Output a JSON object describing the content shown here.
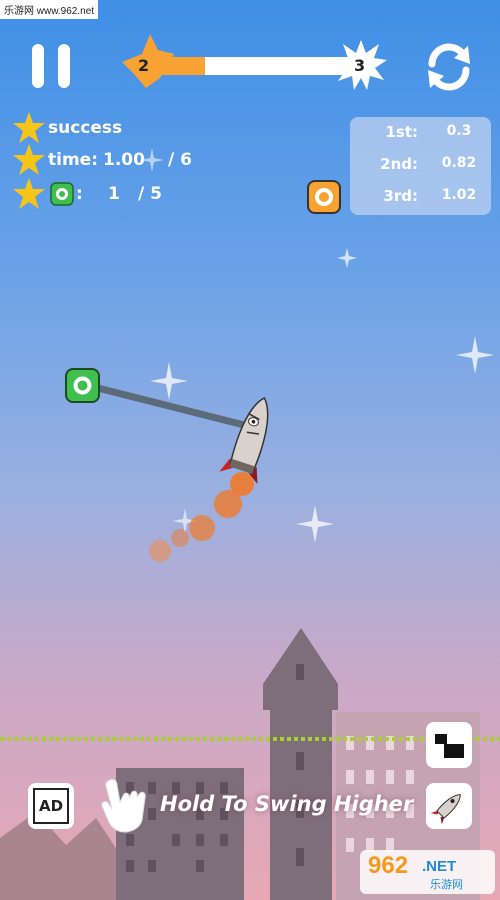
{
  "watermark": {
    "text": "乐游网 www.962.net"
  },
  "progress": {
    "current_level": "2",
    "next_level": "3",
    "fraction": 0.27
  },
  "stats": {
    "success_label": "success",
    "time_label": "time:",
    "time_value": "1.00",
    "time_target": "/ 6",
    "rings_sep": ":",
    "rings_collected": "1",
    "rings_total": "/ 5"
  },
  "rankings": [
    {
      "place": "1st:",
      "time": "0.3"
    },
    {
      "place": "2nd:",
      "time": "0.82"
    },
    {
      "place": "3rd:",
      "time": "1.02"
    }
  ],
  "hint": {
    "text": "Hold To Swing Higher"
  },
  "ad_button": {
    "label": "AD"
  },
  "badge": {
    "number": "962",
    "dotnet": ".NET",
    "cn": "乐游网"
  },
  "colors": {
    "star": "#f5c518",
    "ring": "#3fbf4f",
    "orange_ring": "#f7a233",
    "rope": "#5d6a7a",
    "ground_line": "#a6d22c"
  },
  "icons": [
    "pause-icon",
    "restart-icon",
    "star-icon",
    "green-ring-icon",
    "orange-ring-icon",
    "hand-pointer-icon",
    "ad-icon",
    "blocks-icon",
    "rocket-icon",
    "sparkle-icon"
  ]
}
